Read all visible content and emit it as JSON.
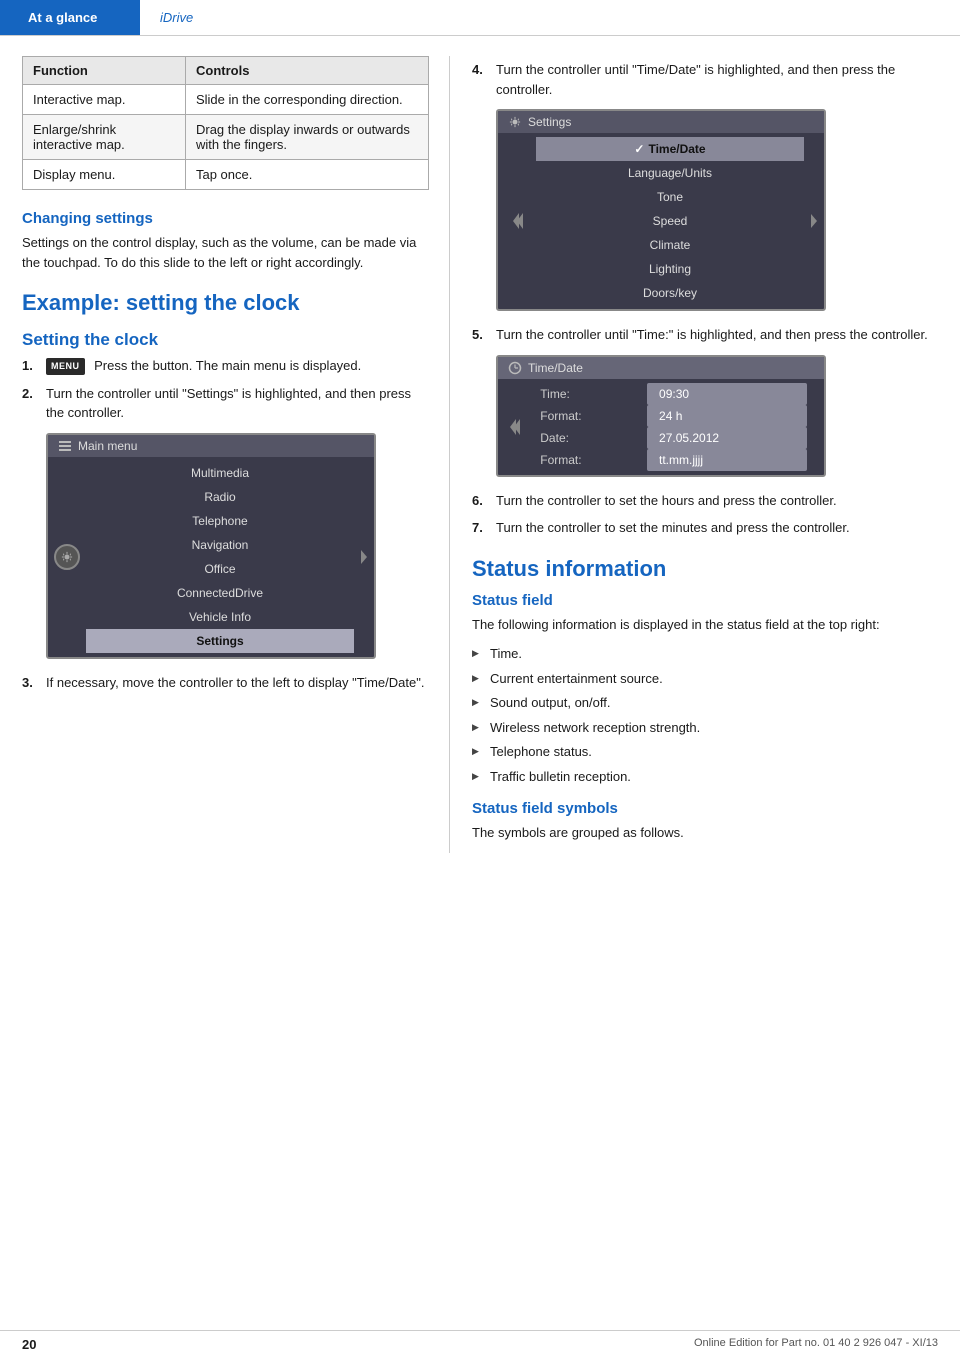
{
  "header": {
    "left_tab": "At a glance",
    "right_tab": "iDrive"
  },
  "table": {
    "col1_header": "Function",
    "col2_header": "Controls",
    "rows": [
      {
        "function": "Interactive map.",
        "controls": "Slide in the corresponding direction."
      },
      {
        "function": "Enlarge/shrink interactive map.",
        "controls": "Drag the display inwards or outwards with the fingers."
      },
      {
        "function": "Display menu.",
        "controls": "Tap once."
      }
    ]
  },
  "changing_settings": {
    "heading": "Changing settings",
    "body": "Settings on the control display, such as the volume, can be made via the touchpad. To do this slide to the left or right accordingly."
  },
  "example_section": {
    "heading": "Example: setting the clock",
    "subsection_heading": "Setting the clock",
    "steps": [
      {
        "num": "1.",
        "text": "Press the button. The main menu is displayed.",
        "has_icon": true
      },
      {
        "num": "2.",
        "text": "Turn the controller until \"Settings\" is highlighted, and then press the controller."
      },
      {
        "num": "3.",
        "text": "If necessary, move the controller to the left to display \"Time/Date\"."
      }
    ]
  },
  "main_menu_screen": {
    "title": "Main menu",
    "items": [
      "Multimedia",
      "Radio",
      "Telephone",
      "Navigation",
      "Office",
      "ConnectedDrive",
      "Vehicle Info",
      "Settings"
    ],
    "active_item": "Settings"
  },
  "right_col": {
    "steps": [
      {
        "num": "4.",
        "text": "Turn the controller until \"Time/Date\" is highlighted, and then press the controller."
      },
      {
        "num": "5.",
        "text": "Turn the controller until \"Time:\" is highlighted, and then press the controller."
      },
      {
        "num": "6.",
        "text": "Turn the controller to set the hours and press the controller."
      },
      {
        "num": "7.",
        "text": "Turn the controller to set the minutes and press the controller."
      }
    ]
  },
  "settings_screen": {
    "title": "Settings",
    "items": [
      "Time/Date",
      "Language/Units",
      "Tone",
      "Speed",
      "Climate",
      "Lighting",
      "Doors/key"
    ],
    "checked_item": "Time/Date"
  },
  "timedate_screen": {
    "title": "Time/Date",
    "rows": [
      {
        "label": "Time:",
        "value": "09:30",
        "active": false
      },
      {
        "label": "Format:",
        "value": "24 h",
        "active": false
      },
      {
        "label": "Date:",
        "value": "27.05.2012",
        "active": false
      },
      {
        "label": "Format:",
        "value": "tt.mm.jjjj",
        "active": false
      }
    ]
  },
  "status_information": {
    "main_heading": "Status information",
    "sub_heading": "Status field",
    "body": "The following information is displayed in the status field at the top right:",
    "items": [
      "Time.",
      "Current entertainment source.",
      "Sound output, on/off.",
      "Wireless network reception strength.",
      "Telephone status.",
      "Traffic bulletin reception."
    ],
    "symbols_heading": "Status field symbols",
    "symbols_body": "The symbols are grouped as follows."
  },
  "footer": {
    "page_num": "20",
    "edition_text": "Online Edition for Part no. 01 40 2 926 047 - XI/13"
  },
  "menu_btn_label": "MENU"
}
